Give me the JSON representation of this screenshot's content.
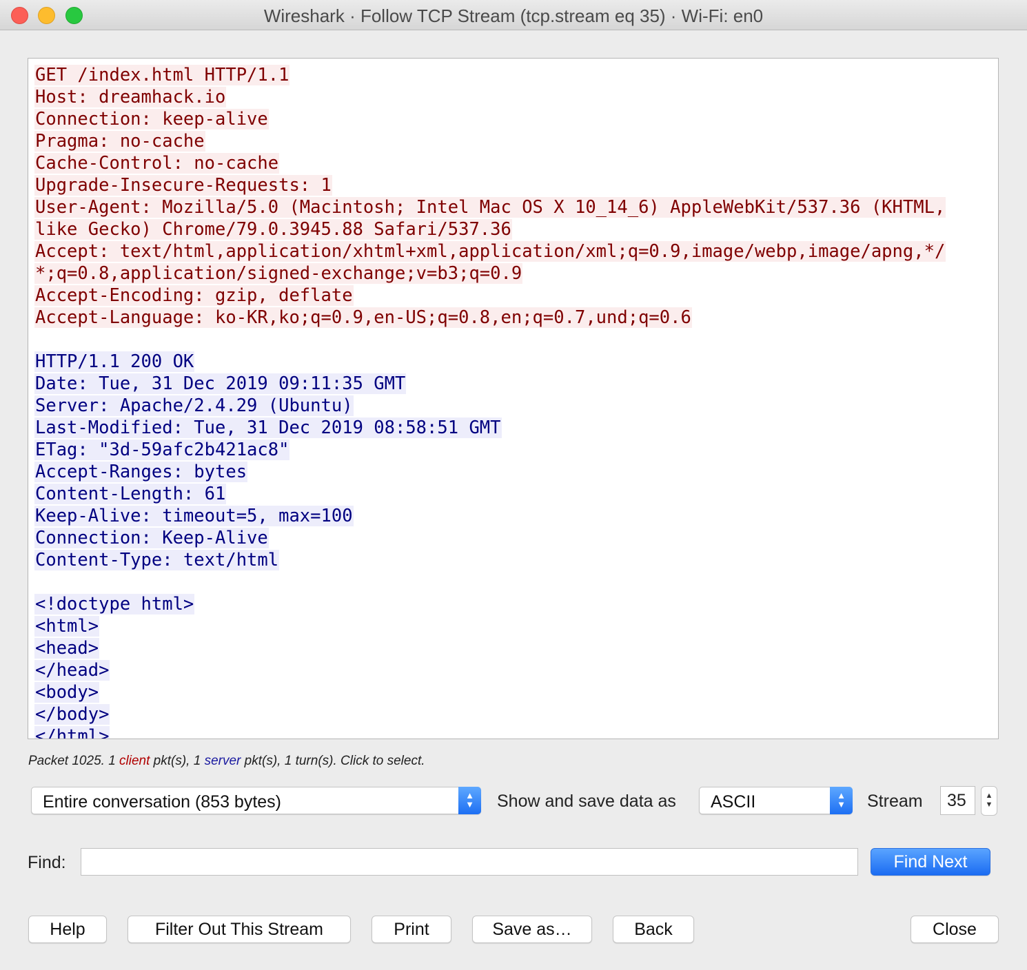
{
  "window": {
    "title": "Wireshark · Follow TCP Stream (tcp.stream eq 35) · Wi-Fi: en0"
  },
  "stream": {
    "client_lines": [
      "GET /index.html HTTP/1.1",
      "Host: dreamhack.io",
      "Connection: keep-alive",
      "Pragma: no-cache",
      "Cache-Control: no-cache",
      "Upgrade-Insecure-Requests: 1",
      "User-Agent: Mozilla/5.0 (Macintosh; Intel Mac OS X 10_14_6) AppleWebKit/537.36 (KHTML,",
      "like Gecko) Chrome/79.0.3945.88 Safari/537.36",
      "Accept: text/html,application/xhtml+xml,application/xml;q=0.9,image/webp,image/apng,*/",
      "*;q=0.8,application/signed-exchange;v=b3;q=0.9",
      "Accept-Encoding: gzip, deflate",
      "Accept-Language: ko-KR,ko;q=0.9,en-US;q=0.8,en;q=0.7,und;q=0.6"
    ],
    "server_lines": [
      "HTTP/1.1 200 OK",
      "Date: Tue, 31 Dec 2019 09:11:35 GMT",
      "Server: Apache/2.4.29 (Ubuntu)",
      "Last-Modified: Tue, 31 Dec 2019 08:58:51 GMT",
      "ETag: \"3d-59afc2b421ac8\"",
      "Accept-Ranges: bytes",
      "Content-Length: 61",
      "Keep-Alive: timeout=5, max=100",
      "Connection: Keep-Alive",
      "Content-Type: text/html"
    ],
    "body_lines": [
      "<!doctype html>",
      "<html>",
      "<head>",
      "</head>",
      "<body>",
      "</body>",
      "</html>"
    ],
    "colors": {
      "client_text": "#7f0000",
      "client_bg": "#fbeded",
      "server_text": "#000080",
      "server_bg": "#ededfb"
    }
  },
  "status": {
    "prefix": "Packet 1025. 1 ",
    "client_word": "client",
    "middle": " pkt(s), 1 ",
    "server_word": "server",
    "suffix": " pkt(s), 1 turn(s). Click to select."
  },
  "controls": {
    "conversation_select": "Entire conversation (853 bytes)",
    "show_label": "Show and save data as",
    "format_select": "ASCII",
    "stream_label": "Stream",
    "stream_value": "35",
    "find_label": "Find:",
    "find_value": "",
    "find_next": "Find Next"
  },
  "buttons": {
    "help": "Help",
    "filter_out": "Filter Out This Stream",
    "print": "Print",
    "save_as": "Save as…",
    "back": "Back",
    "close": "Close"
  }
}
